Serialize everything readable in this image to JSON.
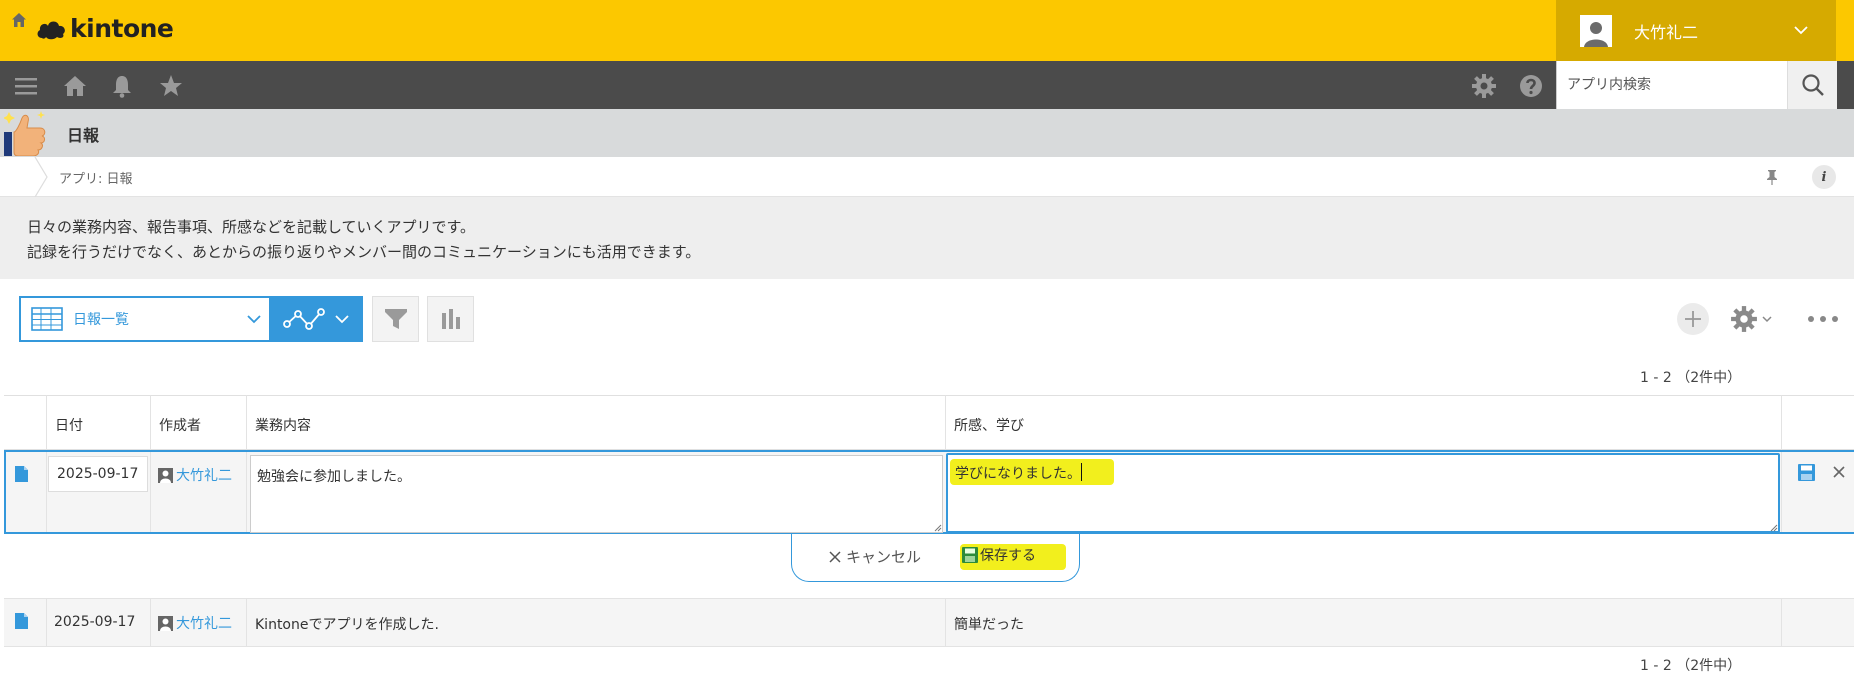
{
  "header": {
    "logo_text": "kintone",
    "user_name": "大竹礼二"
  },
  "nav": {
    "search_placeholder": "アプリ内検索"
  },
  "app": {
    "name": "日報",
    "breadcrumb": "アプリ: 日報",
    "info_label": "i"
  },
  "description": {
    "line1": "日々の業務内容、報告事項、所感などを記載していくアプリです。",
    "line2": "記録を行うだけでなく、あとからの振り返りやメンバー間のコミュニケーションにも活用できます。"
  },
  "toolbar": {
    "view_name": "日報一覧"
  },
  "pager": {
    "text": "1 - 2 （2件中）"
  },
  "table": {
    "columns": [
      "日付",
      "作成者",
      "業務内容",
      "所感、学び"
    ],
    "rows": [
      {
        "date": "2025-09-17",
        "author": "大竹礼二",
        "work": "勉強会に参加しました。",
        "notes": "学びになりました。",
        "editing": true
      },
      {
        "date": "2025-09-17",
        "author": "大竹礼二",
        "work": "Kintoneでアプリを作成した.",
        "notes": "簡単だった",
        "editing": false
      }
    ]
  },
  "edit_actions": {
    "cancel": "キャンセル",
    "save": "保存する"
  },
  "colors": {
    "brand_yellow": "#fcc800",
    "accent_blue": "#3498db",
    "highlight": "#f2ef1d"
  }
}
